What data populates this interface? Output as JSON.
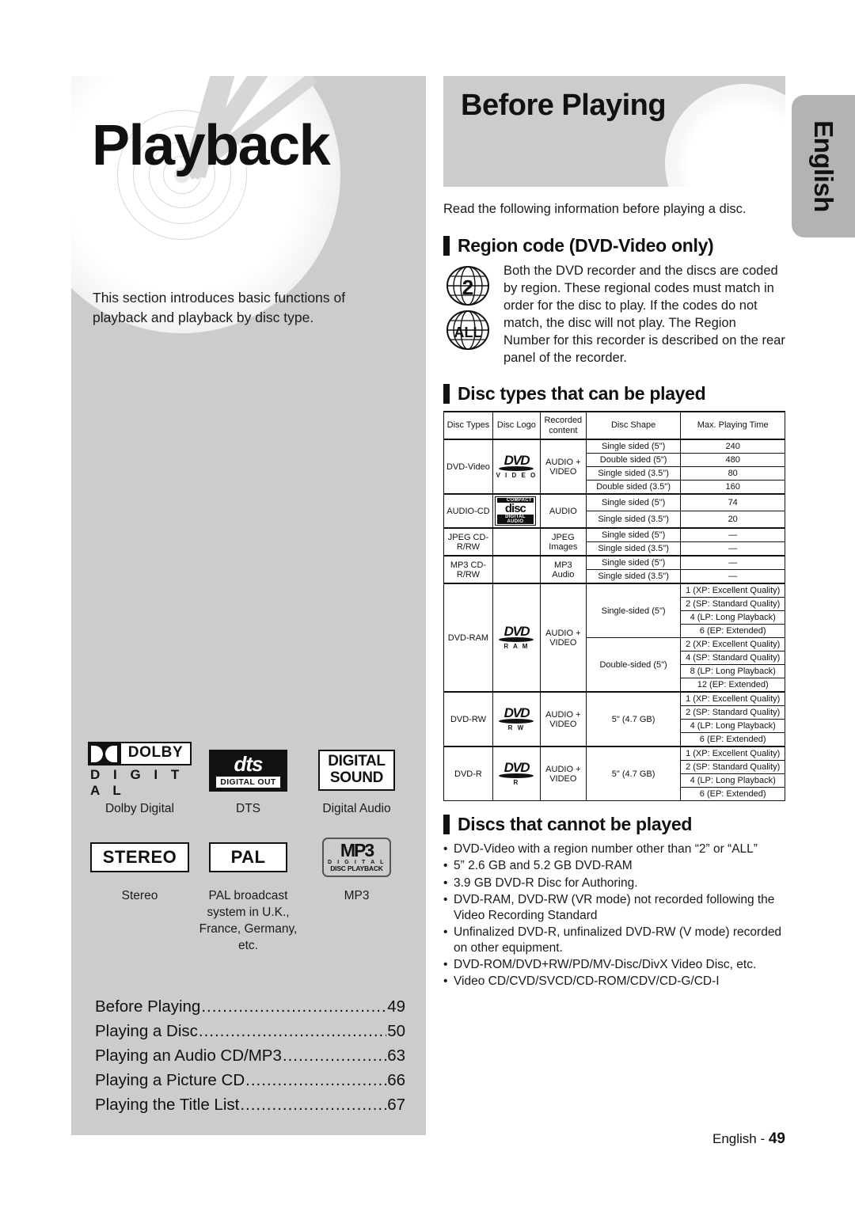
{
  "side_tab": {
    "label": "English"
  },
  "left_page": {
    "title": "Playback",
    "intro": "This section introduces basic functions of playback and playback by disc type.",
    "badges": [
      [
        {
          "name": "dolby-digital-logo",
          "caption": "Dolby Digital",
          "logo_top": "DOLBY",
          "logo_bottom": "D I G I T A L"
        },
        {
          "name": "dts-logo",
          "caption": "DTS",
          "logo_top": "dts",
          "logo_bottom": "DIGITAL OUT"
        },
        {
          "name": "digital-sound-logo",
          "caption": "Digital Audio",
          "logo_top": "DIGITAL",
          "logo_bottom": "SOUND"
        }
      ],
      [
        {
          "name": "stereo-logo",
          "caption": "Stereo",
          "logo_top": "STEREO",
          "logo_bottom": ""
        },
        {
          "name": "pal-logo",
          "caption": "PAL broadcast system in U.K., France, Germany, etc.",
          "logo_top": "PAL",
          "logo_bottom": ""
        },
        {
          "name": "mp3-logo",
          "caption": "MP3",
          "logo_top": "MP3",
          "logo_mid": "D I G I T A L",
          "logo_bottom": "DISC PLAYBACK"
        }
      ]
    ],
    "toc": [
      {
        "label": "Before Playing",
        "page": "49"
      },
      {
        "label": "Playing a Disc",
        "page": "50"
      },
      {
        "label": "Playing an Audio CD/MP3",
        "page": "63"
      },
      {
        "label": "Playing a Picture CD",
        "page": "66"
      },
      {
        "label": "Playing the Title List",
        "page": "67"
      }
    ],
    "dots": "......................................................"
  },
  "right_page": {
    "header_title": "Before Playing",
    "read_line": "Read the following information before playing a disc.",
    "region_section": {
      "heading": "Region code (DVD-Video only)",
      "globe_1": "2",
      "globe_2": "ALL",
      "body": "Both the DVD recorder and the discs are coded by region. These regional codes must match in order for the disc to play. If the codes do not match, the disc will not play. The Region Number for this recorder is described on the rear panel of the recorder."
    },
    "table_section": {
      "heading": "Disc types that can be played",
      "columns": [
        "Disc Types",
        "Disc Logo",
        "Recorded content",
        "Disc Shape",
        "Max. Playing Time"
      ],
      "col_header_recorded_line1": "Recorded",
      "col_header_recorded_line2": "content",
      "rows": [
        {
          "disc_type": "DVD-Video",
          "logo": {
            "kind": "dvd",
            "sub": "V I D E O"
          },
          "recorded": "AUDIO + VIDEO",
          "shapes": [
            {
              "shape": "Single sided (5\")",
              "times": [
                "240"
              ]
            },
            {
              "shape": "Double sided (5\")",
              "times": [
                "480"
              ]
            },
            {
              "shape": "Single sided (3.5\")",
              "times": [
                "80"
              ]
            },
            {
              "shape": "Double sided (3.5\")",
              "times": [
                "160"
              ]
            }
          ]
        },
        {
          "disc_type": "AUDIO-CD",
          "logo": {
            "kind": "cd",
            "top": "COMPACT",
            "mid": "disc",
            "bottom": "DIGITAL AUDIO"
          },
          "recorded": "AUDIO",
          "shapes": [
            {
              "shape": "Single sided (5\")",
              "times": [
                "74"
              ]
            },
            {
              "shape": "Single sided (3.5\")",
              "times": [
                "20"
              ]
            }
          ]
        },
        {
          "disc_type": "JPEG CD-R/RW",
          "logo": {
            "kind": "none"
          },
          "recorded": "JPEG Images",
          "shapes": [
            {
              "shape": "Single sided (5\")",
              "times": [
                "—"
              ]
            },
            {
              "shape": "Single sided (3.5\")",
              "times": [
                "—"
              ]
            }
          ]
        },
        {
          "disc_type": "MP3 CD-R/RW",
          "logo": {
            "kind": "none"
          },
          "recorded": "MP3 Audio",
          "shapes": [
            {
              "shape": "Single sided (5\")",
              "times": [
                "—"
              ]
            },
            {
              "shape": "Single sided (3.5\")",
              "times": [
                "—"
              ]
            }
          ]
        },
        {
          "disc_type": "DVD-RAM",
          "logo": {
            "kind": "dvd",
            "sub": "R A M"
          },
          "recorded": "AUDIO + VIDEO",
          "shapes": [
            {
              "shape": "Single-sided (5\")",
              "times": [
                "1 (XP: Excellent Quality)",
                "2 (SP: Standard Quality)",
                "4 (LP: Long Playback)",
                "6 (EP: Extended)"
              ]
            },
            {
              "shape": "Double-sided (5\")",
              "times": [
                "2 (XP: Excellent Quality)",
                "4 (SP: Standard Quality)",
                "8 (LP: Long Playback)",
                "12 (EP: Extended)"
              ]
            }
          ]
        },
        {
          "disc_type": "DVD-RW",
          "logo": {
            "kind": "dvd",
            "sub": "R W"
          },
          "recorded": "AUDIO + VIDEO",
          "shapes": [
            {
              "shape": "5\" (4.7 GB)",
              "times": [
                "1 (XP: Excellent Quality)",
                "2 (SP: Standard Quality)",
                "4 (LP: Long Playback)",
                "6 (EP: Extended)"
              ]
            }
          ]
        },
        {
          "disc_type": "DVD-R",
          "logo": {
            "kind": "dvd",
            "sub": "R"
          },
          "recorded": "AUDIO + VIDEO",
          "shapes": [
            {
              "shape": "5\" (4.7 GB)",
              "times": [
                "1 (XP: Excellent Quality)",
                "2 (SP: Standard Quality)",
                "4 (LP: Long Playback)",
                "6 (EP: Extended)"
              ]
            }
          ]
        }
      ]
    },
    "cannot_play_section": {
      "heading": "Discs that cannot be played",
      "bullets": [
        "DVD-Video with a region number other than “2” or “ALL”",
        "5” 2.6 GB and 5.2 GB DVD-RAM",
        "3.9 GB DVD-R Disc for Authoring.",
        "DVD-RAM, DVD-RW (VR mode) not recorded following the Video Recording Standard",
        "Unfinalized DVD-R, unfinalized DVD-RW (V mode) recorded on other equipment.",
        "DVD-ROM/DVD+RW/PD/MV-Disc/DivX Video Disc, etc.",
        "Video CD/CVD/SVCD/CD-ROM/CDV/CD-G/CD-I"
      ],
      "bullet_char": "•"
    },
    "footer": {
      "text": "English - ",
      "page": "49"
    }
  }
}
